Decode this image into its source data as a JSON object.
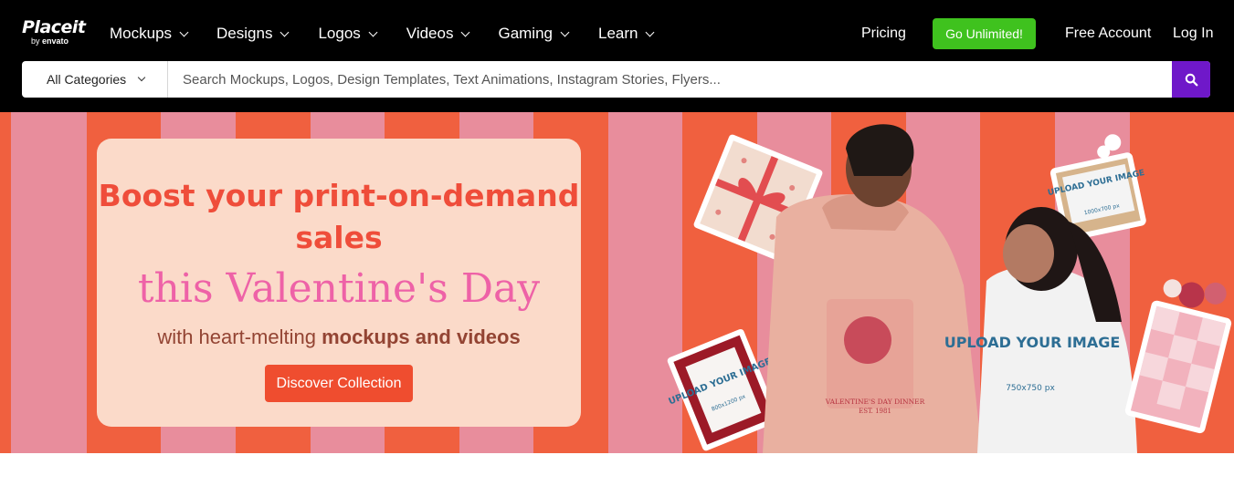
{
  "brand": {
    "name": "Placeit",
    "by": "by",
    "parent": "envato"
  },
  "nav": {
    "items": [
      {
        "label": "Mockups"
      },
      {
        "label": "Designs"
      },
      {
        "label": "Logos"
      },
      {
        "label": "Videos"
      },
      {
        "label": "Gaming"
      },
      {
        "label": "Learn"
      }
    ],
    "pricing": "Pricing",
    "cta": "Go Unlimited!",
    "free_account": "Free Account",
    "login": "Log In"
  },
  "search": {
    "category": "All Categories",
    "placeholder": "Search Mockups, Logos, Design Templates, Text Animations, Instagram Stories, Flyers..."
  },
  "hero": {
    "headline": "Boost your print-on-demand sales",
    "script": "this Valentine's Day",
    "sub_prefix": "with heart-melting ",
    "sub_bold": "mockups and videos",
    "button": "Discover Collection",
    "image_labels": {
      "upload_1": "UPLOAD YOUR IMAGE",
      "dims_1": "1000x700 px",
      "upload_2": "UPLOAD YOUR IMAGE",
      "dims_2": "800x1200 px",
      "upload_3": "UPLOAD YOUR IMAGE",
      "dims_3": "750x750 px",
      "shirt_text": "VALENTINE'S DAY DINNER",
      "shirt_est": "EST. 1981"
    }
  },
  "colors": {
    "topbar": "#000000",
    "cta_green": "#3fc21e",
    "search_purple": "#6f18c9",
    "stripe_orange": "#f0603f",
    "stripe_pink": "#e88d9c",
    "card_bg": "#fbdac9",
    "headline_red": "#ef4d3a",
    "script_pink": "#ee62a7",
    "button_red": "#ef4d2f"
  }
}
